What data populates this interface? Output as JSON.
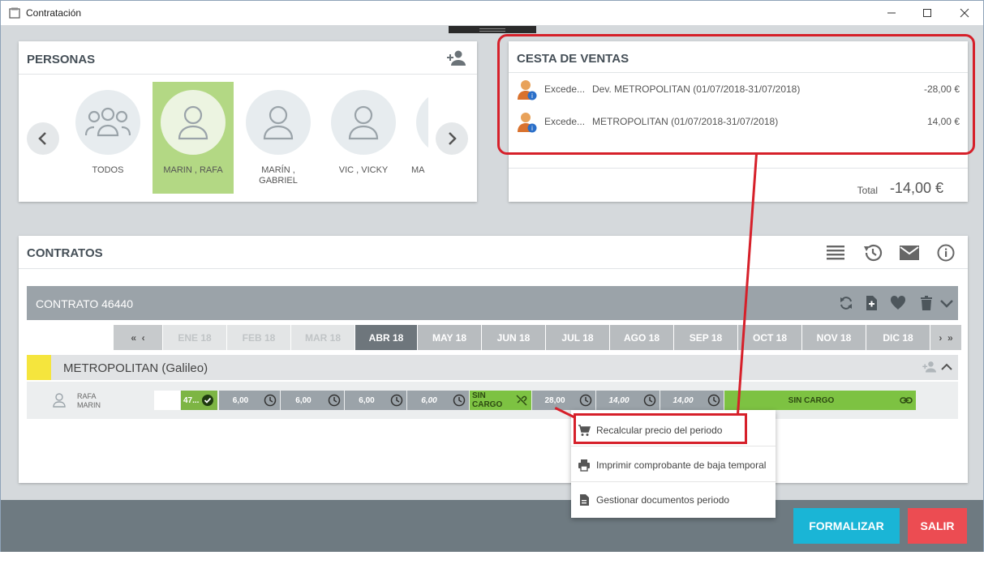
{
  "window": {
    "title": "Contratación"
  },
  "personas": {
    "title": "PERSONAS",
    "people": [
      {
        "label": "TODOS"
      },
      {
        "label": "MARIN , RAFA"
      },
      {
        "label": "MARÍN ,",
        "label2": "GABRIEL"
      },
      {
        "label": "VIC , VICKY"
      },
      {
        "label": "MA"
      }
    ]
  },
  "cesta": {
    "title": "CESTA DE VENTAS",
    "lines": [
      {
        "type": "Excede...",
        "desc": "Dev. METROPOLITAN (01/07/2018-31/07/2018)",
        "amount": "-28,00 €"
      },
      {
        "type": "Excede...",
        "desc": "METROPOLITAN (01/07/2018-31/07/2018)",
        "amount": "14,00 €"
      }
    ],
    "total_label": "Total",
    "total_value": "-14,00 €"
  },
  "contratos": {
    "title": "CONTRATOS",
    "contract_label": "CONTRATO 46440",
    "months": [
      "ENE 18",
      "FEB 18",
      "MAR 18",
      "ABR 18",
      "MAY 18",
      "JUN 18",
      "JUL 18",
      "AGO 18",
      "SEP 18",
      "OCT 18",
      "NOV 18",
      "DIC 18"
    ],
    "service": "METROPOLITAN (Galileo)",
    "person_first": "RAFA",
    "person_last": "MARIN",
    "cells": [
      "47...",
      "6,00",
      "6,00",
      "6,00",
      "6,00",
      "SIN CARGO",
      "28,00",
      "14,00",
      "14,00",
      "SIN CARGO"
    ]
  },
  "context_menu": {
    "items": [
      "Recalcular precio del periodo",
      "Imprimir comprobante de baja temporal",
      "Gestionar documentos periodo"
    ]
  },
  "buttons": {
    "formalizar": "FORMALIZAR",
    "salir": "SALIR"
  }
}
